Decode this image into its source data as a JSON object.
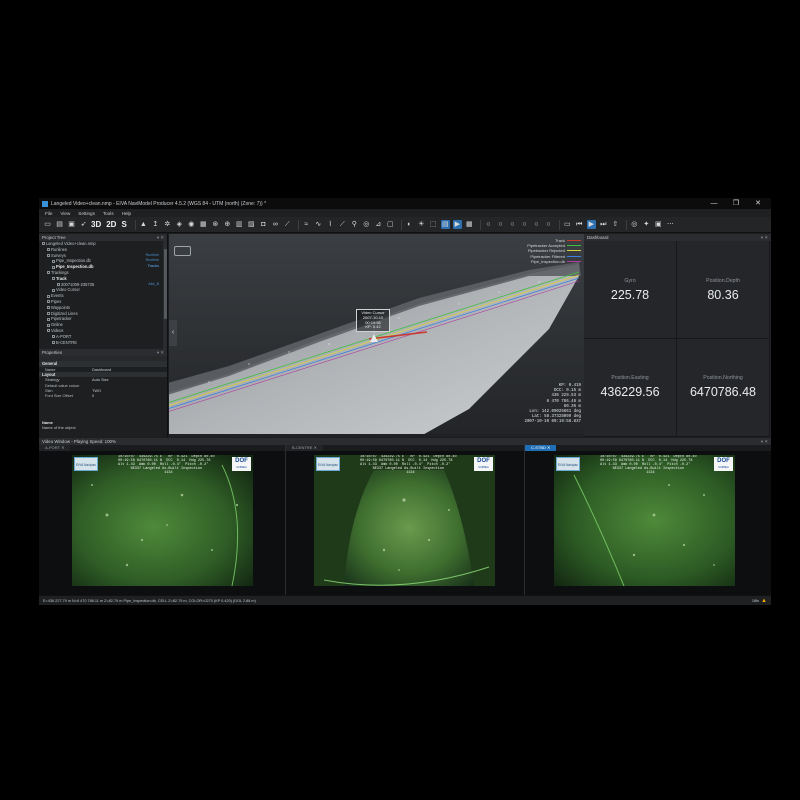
{
  "window": {
    "title": "Langeled Video+clean.nmp - EIVA NaviModel Producer 4.5.2 (WGS 84 - UTM (north) (Zone: 7)) *",
    "minimize": "—",
    "maximize": "❐",
    "close": "✕"
  },
  "menu": [
    "File",
    "View",
    "Settings",
    "Tools",
    "Help"
  ],
  "toolbar": {
    "btn_3d": "3D",
    "btn_2d": "2D",
    "btn_s": "S"
  },
  "project_tree": {
    "title": "Project Tree",
    "items": [
      {
        "label": "Langeled Video+clean.nmp",
        "indent": 0,
        "tag": "",
        "bold": false
      },
      {
        "label": "Runlines",
        "indent": 1,
        "tag": "",
        "bold": false
      },
      {
        "label": "Surveys",
        "indent": 1,
        "tag": "Runtime",
        "bold": false
      },
      {
        "label": "Pipe_Inspection.db",
        "indent": 2,
        "tag": "Runtime",
        "bold": false
      },
      {
        "label": "Pipe_Inspection.db",
        "indent": 2,
        "tag": "Tracks",
        "bold": true
      },
      {
        "label": "Trackings",
        "indent": 1,
        "tag": "",
        "bold": false
      },
      {
        "label": "Track",
        "indent": 2,
        "tag": "",
        "bold": true
      },
      {
        "label": "20071009-235735",
        "indent": 3,
        "tag": "Abs_B",
        "bold": false
      },
      {
        "label": "Video Cursor",
        "indent": 2,
        "tag": "",
        "bold": false
      },
      {
        "label": "Events",
        "indent": 1,
        "tag": "",
        "bold": false
      },
      {
        "label": "Pipes",
        "indent": 1,
        "tag": "",
        "bold": false
      },
      {
        "label": "Waypoints",
        "indent": 1,
        "tag": "",
        "bold": false
      },
      {
        "label": "Digitized Lines",
        "indent": 1,
        "tag": "",
        "bold": false
      },
      {
        "label": "Pipetracker",
        "indent": 1,
        "tag": "",
        "bold": false
      },
      {
        "label": "Online",
        "indent": 1,
        "tag": "",
        "bold": false
      },
      {
        "label": "Videos",
        "indent": 1,
        "tag": "",
        "bold": false
      },
      {
        "label": "A-PORT",
        "indent": 2,
        "tag": "",
        "bold": false
      },
      {
        "label": "B-CENTRE",
        "indent": 2,
        "tag": "",
        "bold": false
      }
    ]
  },
  "properties": {
    "title": "Properties",
    "section_general": "General",
    "section_layout": "Layout",
    "rows_general": [
      {
        "k": "Name",
        "v": "Dashboard"
      }
    ],
    "rows_layout": [
      {
        "k": "Strategy",
        "v": "Auto Size"
      },
      {
        "k": "Default value colour",
        "v": ""
      },
      {
        "k": "Skin",
        "v": "TWO"
      },
      {
        "k": "Font Size Offset",
        "v": "0"
      }
    ],
    "desc_title": "Name",
    "desc_text": "Name of the object"
  },
  "view3d": {
    "legend": [
      {
        "label": "Track",
        "color": "#c83a2e"
      },
      {
        "label": "Pipetracker Accepted",
        "color": "#3fbf3f"
      },
      {
        "label": "Pipetracker Rejected",
        "color": "#d9d23a"
      },
      {
        "label": "Pipetracker Filtered",
        "color": "#3f7fdf"
      },
      {
        "label": "Pipe_Inspection.db",
        "color": "#b03a9f"
      }
    ],
    "video_cursor": {
      "title": "Video Cursor",
      "date": "2007-10-10",
      "time": "00:19:58",
      "kp": "KP: 0.42"
    },
    "readout": [
      "KP: 0.419",
      "DCC: 0.15 m",
      "436 229.53 m",
      "6 470 786.46 m",
      "80.36 m",
      "Lon: 142.09025661 deg",
      "Lat: 58.37328099 deg",
      "2007-10-10 00:19:58.837"
    ]
  },
  "dashboard": {
    "title": "Dashboard",
    "cells": [
      {
        "label": "Gyro",
        "value": "225.78"
      },
      {
        "label": "Position.Depth",
        "value": "80.36"
      },
      {
        "label": "Position.Easting",
        "value": "436229.56"
      },
      {
        "label": "Position.Northing",
        "value": "6470786.48"
      }
    ]
  },
  "video_window": {
    "title": "Video Window - Playing Speed: 100%",
    "panes": [
      {
        "tab": "A-PORT",
        "active": false,
        "overlay": "10/10/07  436229.75 E   KP  0.421  Depth 80.40\n00:19:58 6470780.11 N  DCC  0.14  Hdg 225.78\nAlt 1.43  Amb 0.00  Roll -0.4°  Pitch -0.2°\n      NE337 Langeled As-Built Inspection\n                      1134"
      },
      {
        "tab": "B-CENTRE",
        "active": false,
        "overlay": "10/10/07  436229.75 E   KP  0.421  Depth 80.40\n00:19:58 6470780.11 N  DCC  0.14  Hdg 225.78\nAlt 1.43  Amb 0.00  Roll -0.4°  Pitch -0.2°\n      NE337 Langeled As-Built Inspection\n                      1134"
      },
      {
        "tab": "C-STBD",
        "active": true,
        "overlay": "10/10/07  436229.75 E   KP  0.421  Depth 80.40\n00:19:58 6470780.11 N  DCC  0.14  Hdg 225.78\nAlt 1.43  Amb 0.00  Roll -0.4°  Pitch -0.2°\n      NE337 Langeled As-Built Inspection\n                      1134"
      }
    ],
    "logo_left": "EIVA Navipac",
    "logo_right": "DOF",
    "logo_right_sub": "SUBSEA"
  },
  "status": {
    "text": "E=436 227.79 m N=6 470 786.11 m Z=82.79 m Pipe_Inspection.db, CELL Z=82.79 m, COLOR=0270 (KP 0.420) (DOL 2.88 m)",
    "right": "18fs"
  }
}
